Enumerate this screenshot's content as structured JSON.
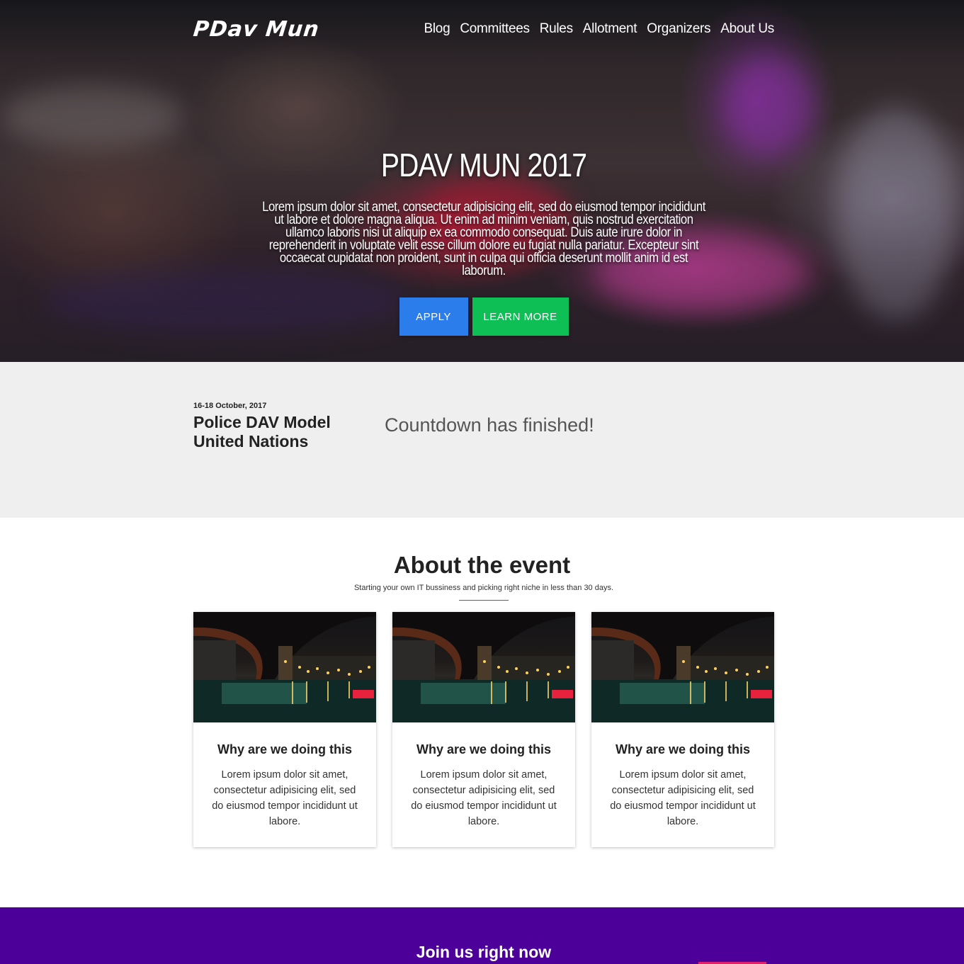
{
  "brand": {
    "logo": "PDav Mun"
  },
  "nav": {
    "items": [
      {
        "label": "Blog"
      },
      {
        "label": "Committees"
      },
      {
        "label": "Rules"
      },
      {
        "label": "Allotment"
      },
      {
        "label": "Organizers"
      },
      {
        "label": "About Us"
      }
    ]
  },
  "hero": {
    "title": "PDAV MUN 2017",
    "text": "Lorem ipsum dolor sit amet, consectetur adipisicing elit, sed do eiusmod tempor incididunt ut labore et dolore magna aliqua. Ut enim ad minim veniam, quis nostrud exercitation ullamco laboris nisi ut aliquip ex ea commodo consequat. Duis aute irure dolor in reprehenderit in voluptate velit esse cillum dolore eu fugiat nulla pariatur. Excepteur sint occaecat cupidatat non proident, sunt in culpa qui officia deserunt mollit anim id est laborum.",
    "apply_label": "APPLY",
    "learn_label": "LEARN MORE",
    "apply_color": "#2a7dea",
    "learn_color": "#0dbf55"
  },
  "event": {
    "date": "16-18 October, 2017",
    "name": "Police DAV Model United Nations",
    "countdown_message": "Countdown has finished!"
  },
  "about": {
    "title": "About the event",
    "subtitle": "Starting your own IT bussiness and picking right niche in less than 30 days.",
    "accent_color": "#e0206a",
    "cards": [
      {
        "image": "night-canal-bridge-photo",
        "title": "Why are we doing this",
        "text": "Lorem ipsum dolor sit amet, consectetur adipisicing elit, sed do eiusmod tempor incididunt ut labore."
      },
      {
        "image": "night-canal-bridge-photo",
        "title": "Why are we doing this",
        "text": "Lorem ipsum dolor sit amet, consectetur adipisicing elit, sed do eiusmod tempor incididunt ut labore."
      },
      {
        "image": "night-canal-bridge-photo",
        "title": "Why are we doing this",
        "text": "Lorem ipsum dolor sit amet, consectetur adipisicing elit, sed do eiusmod tempor incididunt ut labore."
      }
    ]
  },
  "join": {
    "title": "Join us right now",
    "background": "#4c0099"
  }
}
